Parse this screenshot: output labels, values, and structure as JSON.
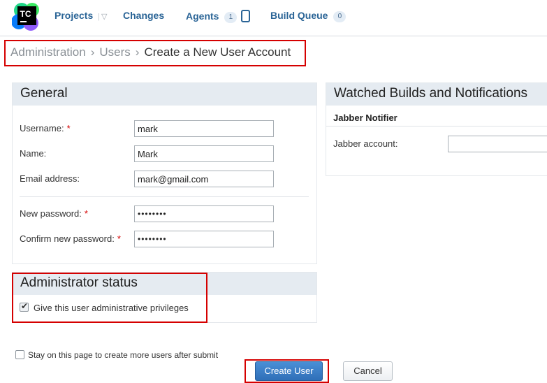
{
  "nav": {
    "logo_text": "TC",
    "projects": "Projects",
    "changes": "Changes",
    "agents": "Agents",
    "agents_count": "1",
    "build_queue": "Build Queue",
    "build_queue_count": "0"
  },
  "breadcrumb": {
    "admin": "Administration",
    "users": "Users",
    "current": "Create a New User Account",
    "separator": ">"
  },
  "general": {
    "title": "General",
    "username_label": "Username:",
    "username_value": "mark",
    "name_label": "Name:",
    "name_value": "Mark",
    "email_label": "Email address:",
    "email_value": "mark@gmail.com",
    "new_password_label": "New password:",
    "new_password_value": "••••••••",
    "confirm_password_label": "Confirm new password:",
    "confirm_password_value": "••••••••",
    "required_mark": "*"
  },
  "admin_status": {
    "title": "Administrator status",
    "checkbox_label": "Give this user administrative privileges",
    "checked": true
  },
  "watched": {
    "title": "Watched Builds and Notifications",
    "jabber_title": "Jabber Notifier",
    "jabber_account_label": "Jabber account:",
    "jabber_account_value": ""
  },
  "footer": {
    "stay_label": "Stay on this page to create more users after submit",
    "stay_checked": false,
    "create_button": "Create User",
    "cancel_button": "Cancel"
  },
  "colors": {
    "accent": "#2a6496",
    "highlight": "#d50000",
    "panel_header": "#e5ebf1",
    "primary_button": "#2f6fb8"
  }
}
